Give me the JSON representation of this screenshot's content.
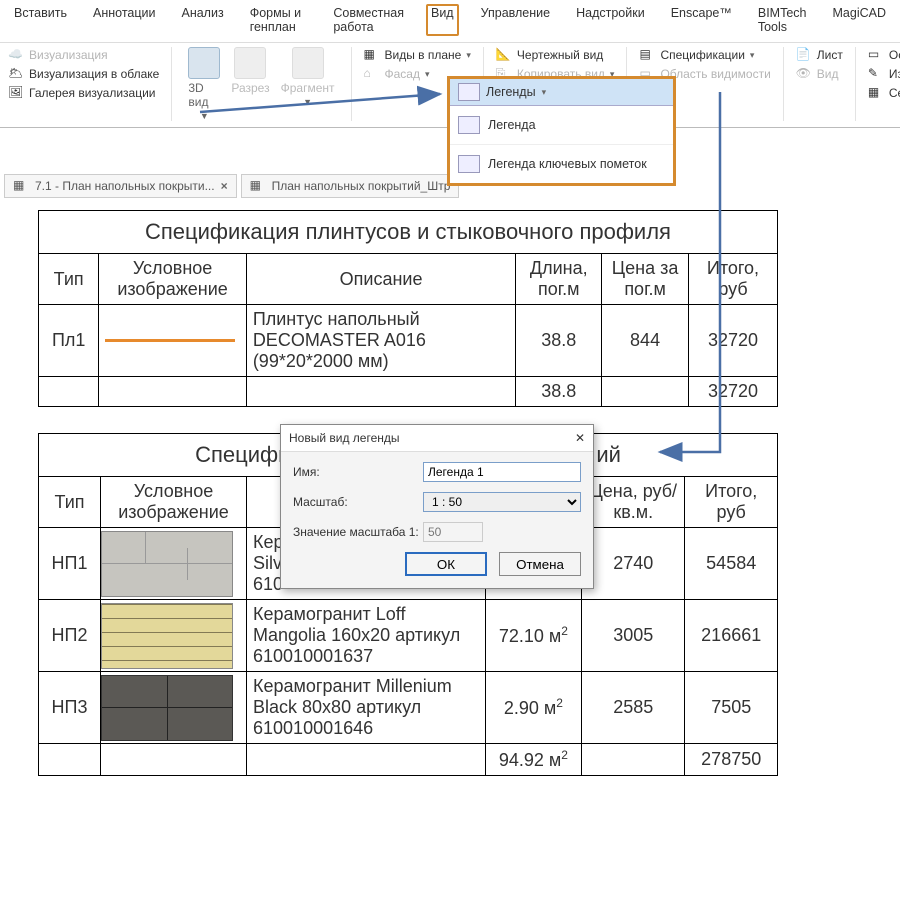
{
  "menu": {
    "items": [
      "Вставить",
      "Аннотации",
      "Анализ",
      "Формы и генплан",
      "Совместная работа",
      "Вид",
      "Управление",
      "Надстройки",
      "Enscape™",
      "BIMTech Tools",
      "MagiCAD"
    ],
    "active_index": 5
  },
  "ribbon": {
    "g1": {
      "a": "Визуализация",
      "b": "Визуализация  в облаке",
      "c": "Галерея  визуализации"
    },
    "g2": {
      "a": "3D вид",
      "b": "Разрез",
      "c": "Фрагмент"
    },
    "g3": {
      "a": "Виды в плане",
      "b": "Фасад",
      "c": "Чертежный вид",
      "d": "Копировать вид",
      "e": "Спецификации",
      "f": "Область видимости"
    },
    "g4": {
      "a": "Лист",
      "b": "Вид",
      "c": "Основная надпись",
      "d": "Изменения",
      "e": "Сетка направляющ"
    }
  },
  "dropdown": {
    "header": "Легенды",
    "items": [
      "Легенда",
      "Легенда ключевых пометок"
    ]
  },
  "tabs": {
    "t1": "7.1 - План напольных покрыти...",
    "t2": "План напольных покрытий_Штр"
  },
  "table1": {
    "title": "Спецификация плинтусов и стыковочного профиля",
    "headers": [
      "Тип",
      "Условное изображение",
      "Описание",
      "Длина, пог.м",
      "Цена за пог.м",
      "Итого, руб"
    ],
    "rows": [
      {
        "type": "Пл1",
        "desc": "Плинтус напольный DECOMASTER A016 (99*20*2000 мм)",
        "len": "38.8",
        "price": "844",
        "total": "32720"
      }
    ],
    "totals": {
      "len": "38.8",
      "total": "32720"
    }
  },
  "table2": {
    "title_left": "Специфи",
    "title_right": "ий",
    "headers": [
      "Тип",
      "Условное изображение",
      "",
      "",
      "Цена, руб/кв.м.",
      "Итого, руб"
    ],
    "rows": [
      {
        "type": "НП1",
        "desc_a": "Кер",
        "desc_b": "Silv",
        "desc_c": "610",
        "price": "2740",
        "total": "54584"
      },
      {
        "type": "НП2",
        "desc": "Керамогранит Loff Mangolia 160x20 артикул 610010001637",
        "area": "72.10 м",
        "price": "3005",
        "total": "216661"
      },
      {
        "type": "НП3",
        "desc": "Керамогранит Millenium Black 80x80 артикул 610010001646",
        "area": "2.90 м",
        "price": "2585",
        "total": "7505"
      }
    ],
    "totals": {
      "area": "94.92 м",
      "total": "278750"
    }
  },
  "dialog": {
    "title": "Новый вид легенды",
    "name_label": "Имя:",
    "name_value": "Легенда 1",
    "scale_label": "Масштаб:",
    "scale_value": "1 : 50",
    "scaleval_label": "Значение масштаба 1:",
    "scaleval_value": "50",
    "ok": "ОК",
    "cancel": "Отмена"
  }
}
